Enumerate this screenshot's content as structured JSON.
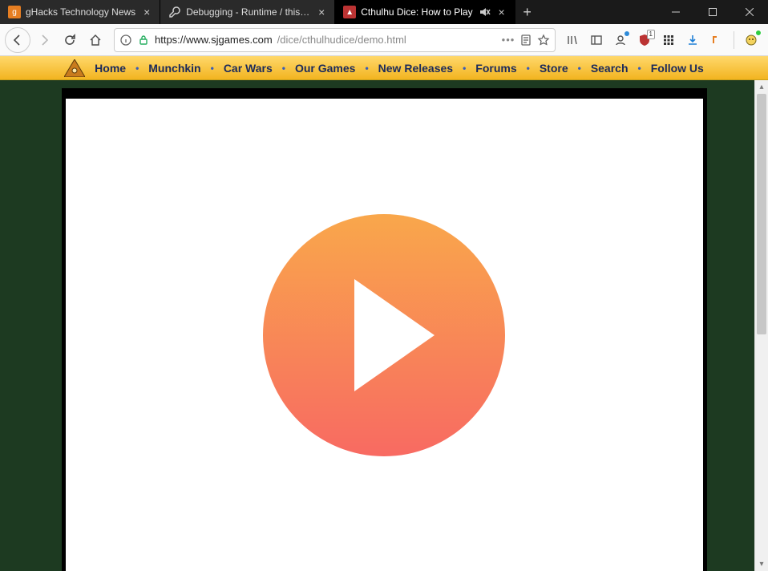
{
  "window": {
    "tabs": [
      {
        "title": "gHacks Technology News",
        "active": false
      },
      {
        "title": "Debugging - Runtime / this-fir",
        "active": false
      },
      {
        "title": "Cthulhu Dice: How to Play",
        "active": true,
        "muted": true
      }
    ]
  },
  "toolbar": {
    "url_host": "https://www.sjgames.com",
    "url_path": "/dice/cthulhudice/demo.html"
  },
  "sitenav": {
    "items": [
      "Home",
      "Munchkin",
      "Car Wars",
      "Our Games",
      "New Releases",
      "Forums",
      "Store",
      "Search",
      "Follow Us"
    ]
  },
  "extensions": {
    "ublock_badge": "1"
  }
}
